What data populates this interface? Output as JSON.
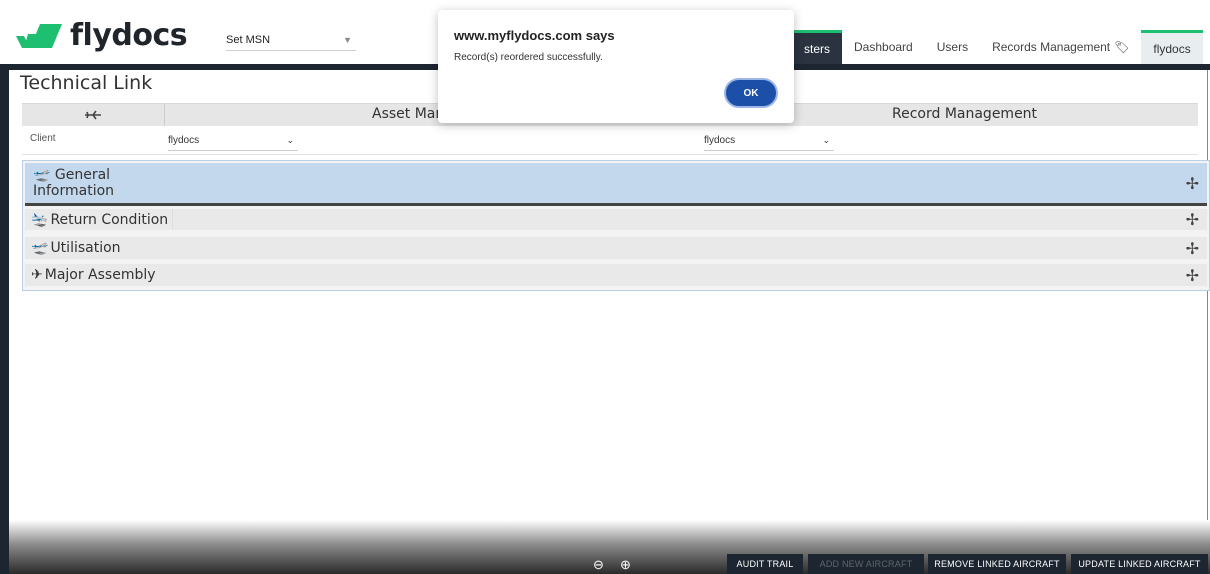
{
  "header": {
    "logo_text": "flydocs",
    "msn_select": {
      "label": "Set MSN"
    },
    "nav": [
      {
        "label": "sters",
        "state": "active"
      },
      {
        "label": "Dashboard"
      },
      {
        "label": "Users"
      },
      {
        "label": "Records Management"
      },
      {
        "label": "flydocs",
        "state": "highlighted"
      }
    ],
    "logout_icon": "logout-arrow-icon"
  },
  "page": {
    "title": "Technical Link",
    "table_header": {
      "icon": "aircraft-icon",
      "asset_col": "Asset Mana",
      "record_col": "Record Management"
    },
    "client_row": {
      "label": "Client",
      "asset_client": "flydocs",
      "record_client": "flydocs"
    }
  },
  "sections": [
    {
      "label": "General",
      "label2": "Information",
      "icon": "airplane-takeoff-icon",
      "active": true
    },
    {
      "label": "Return Condition",
      "icon": "airplane-landing-icon"
    },
    {
      "label": "Utilisation",
      "icon": "airplane-takeoff-icon"
    },
    {
      "label": "Major Assembly",
      "icon": "aircraft-icon"
    }
  ],
  "dialog": {
    "origin": "www.myflydocs.com says",
    "message": "Record(s) reordered successfully.",
    "ok_label": "OK"
  },
  "footer": {
    "zoom_out_icon": "zoom-out-icon",
    "zoom_in_icon": "zoom-in-icon",
    "buttons": [
      {
        "label": "AUDIT TRAIL"
      },
      {
        "label": "ADD NEW AIRCRAFT",
        "disabled": true
      },
      {
        "label": "REMOVE LINKED AIRCRAFT"
      },
      {
        "label": "UPDATE LINKED AIRCRAFT"
      }
    ]
  },
  "colors": {
    "brand_green": "#1fbf72",
    "dark_nav": "#1d2530",
    "dialog_button": "#1b4fa8",
    "section_active": "#c3d8ec"
  }
}
